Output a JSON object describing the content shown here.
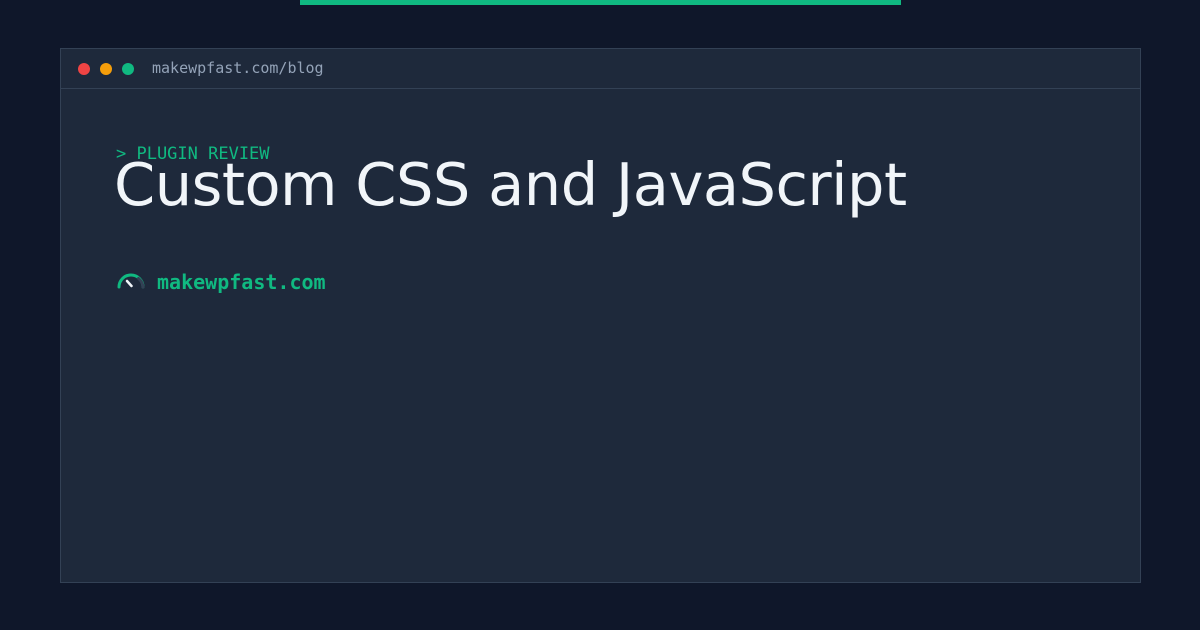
{
  "colors": {
    "background": "#0f172a",
    "window_background": "#1e293b",
    "accent": "#10b981",
    "title_text": "#f1f5f9",
    "muted_text": "#94a3b8",
    "dot_close": "#ef4444",
    "dot_minimize": "#f59e0b",
    "dot_maximize": "#10b981"
  },
  "window": {
    "titlebar": {
      "url": "makewpfast.com/blog",
      "dots": [
        "close",
        "minimize",
        "maximize"
      ]
    },
    "eyebrow": "> PLUGIN REVIEW",
    "title": "Custom CSS and JavaScript",
    "brand": {
      "icon": "speedometer-icon",
      "name": "makewpfast.com"
    }
  }
}
